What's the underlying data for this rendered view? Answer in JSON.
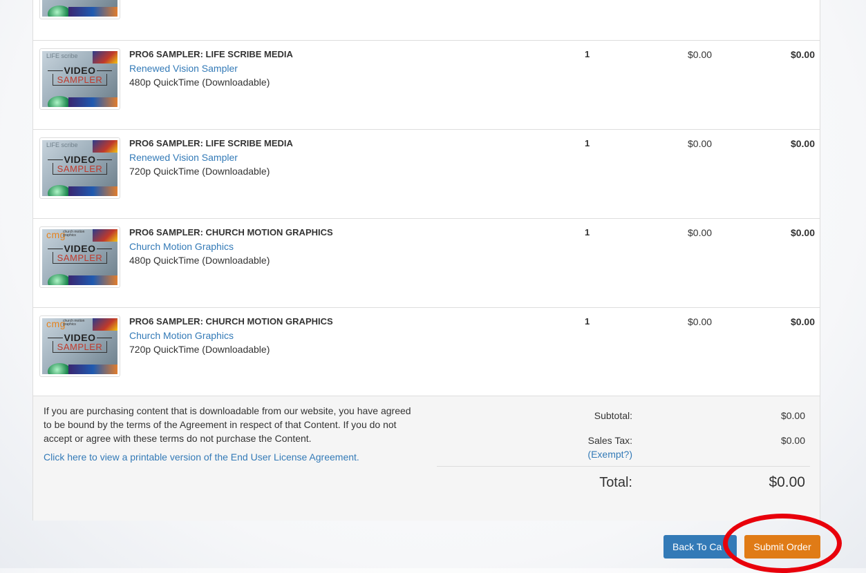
{
  "items": [
    {
      "title": "PRO6 SAMPLER: LIFE SCRIBE MEDIA",
      "vendor": "Renewed Vision Sampler",
      "format": "480p QuickTime (Downloadable)",
      "qty": "1",
      "price": "$0.00",
      "total": "$0.00",
      "brand": "LIFE scribe",
      "thumb_top": "VIDEO",
      "thumb_bottom": "SAMPLER"
    },
    {
      "title": "PRO6 SAMPLER: LIFE SCRIBE MEDIA",
      "vendor": "Renewed Vision Sampler",
      "format": "720p QuickTime (Downloadable)",
      "qty": "1",
      "price": "$0.00",
      "total": "$0.00",
      "brand": "LIFE scribe",
      "thumb_top": "VIDEO",
      "thumb_bottom": "SAMPLER"
    },
    {
      "title": "PRO6 SAMPLER: CHURCH MOTION GRAPHICS",
      "vendor": "Church Motion Graphics",
      "format": "480p QuickTime (Downloadable)",
      "qty": "1",
      "price": "$0.00",
      "total": "$0.00",
      "brand": "cmg",
      "brand_sub": "church motion graphics",
      "thumb_top": "VIDEO",
      "thumb_bottom": "SAMPLER"
    },
    {
      "title": "PRO6 SAMPLER: CHURCH MOTION GRAPHICS",
      "vendor": "Church Motion Graphics",
      "format": "720p QuickTime (Downloadable)",
      "qty": "1",
      "price": "$0.00",
      "total": "$0.00",
      "brand": "cmg",
      "brand_sub": "church motion graphics",
      "thumb_top": "VIDEO",
      "thumb_bottom": "SAMPLER"
    }
  ],
  "summary": {
    "terms_text": "If you are purchasing content that is downloadable from our website, you have agreed to be bound by the terms of the Agreement in respect of that Content. If you do not accept or agree with these terms do not purchase the Content.",
    "eula_link": "Click here to view a printable version of the End User License Agreement.",
    "subtotal_label": "Subtotal:",
    "subtotal_value": "$0.00",
    "tax_label": "Sales Tax:",
    "tax_value": "$0.00",
    "exempt_link": "(Exempt?)",
    "total_label": "Total:",
    "total_value": "$0.00"
  },
  "buttons": {
    "back": "Back To Ca",
    "submit": "Submit Order"
  },
  "colors": {
    "link": "#337ab7",
    "submit": "#e07b16",
    "highlight": "#e8000b"
  }
}
